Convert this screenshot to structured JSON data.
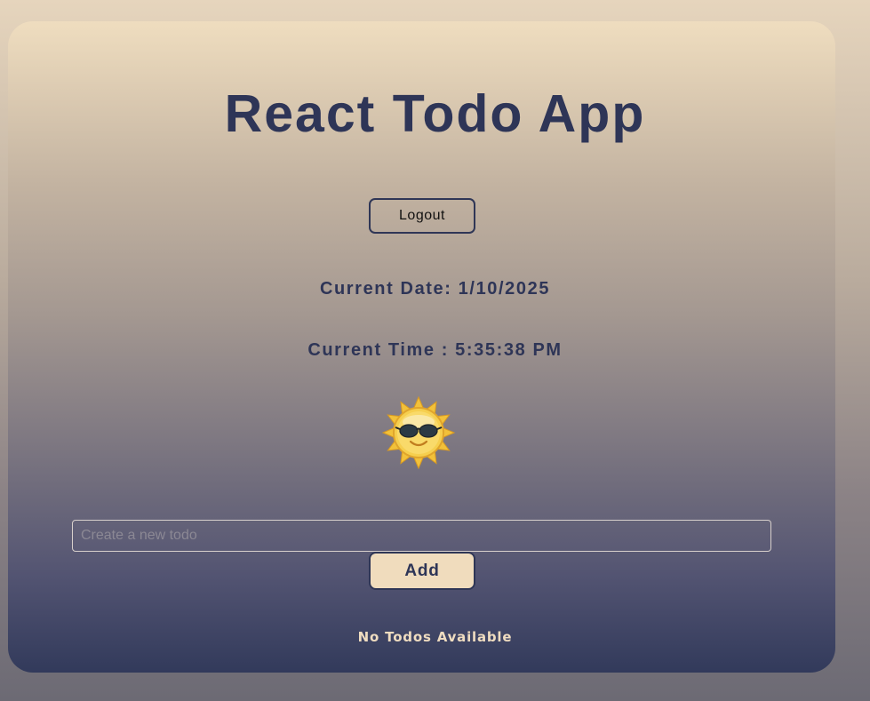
{
  "app": {
    "title": "React Todo App"
  },
  "header": {
    "logout_label": "Logout"
  },
  "clock": {
    "date_text": "Current Date: 1/10/2025",
    "time_text": "Current Time : 5:35:38 PM",
    "weather_icon": "sun-with-sunglasses-icon"
  },
  "todo_form": {
    "input_value": "",
    "input_placeholder": "Create a new todo",
    "add_label": "Add"
  },
  "todo_list": {
    "empty_message": "No Todos Available",
    "items": []
  },
  "colors": {
    "text_primary": "#2e3557",
    "accent_button": "#f0dcbd",
    "empty_message": "#efdcc0"
  }
}
